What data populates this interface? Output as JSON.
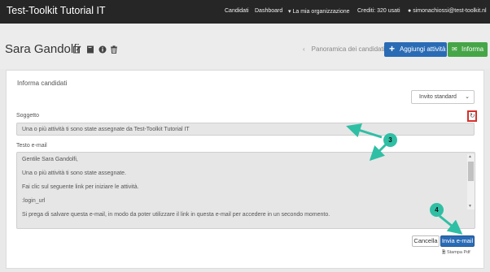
{
  "topnav": {
    "brand": "Test-Toolkit Tutorial IT",
    "items": [
      {
        "label": "Candidati"
      },
      {
        "label": "Dashboard"
      },
      {
        "label": "La mia organizzazione"
      },
      {
        "label": "Crediti: 320 usati"
      },
      {
        "label": "simonachiossi@test-toolkit.nl"
      }
    ]
  },
  "header": {
    "title": "Sara Gandolfi",
    "icons": [
      "edit-icon",
      "notes-icon",
      "info-icon",
      "trash-icon"
    ],
    "back_link": "Panoramica dei candidati",
    "add_activity": "Aggiungi attività",
    "inform": "Informa"
  },
  "panel": {
    "title": "Informa candidati",
    "template_select": "Invito standard",
    "subject_label": "Soggetto",
    "subject_value": "Una o più attività ti sono state assegnate da Test-Toolkit Tutorial IT",
    "email_label": "Testo e-mail",
    "email_lines": [
      "Gentile Sara Gandolfi,",
      "Una o più attività ti sono state assegnate.",
      "Fai clic sul seguente link per iniziare le attività.",
      ":login_url",
      "Si prega di salvare questa e-mail, in modo da poter utilizzare il link in questa e-mail per accedere in un secondo momento."
    ],
    "cancel": "Cancella",
    "send": "Invia e-mail",
    "print": "Stampa Pdf"
  },
  "annotations": [
    "3",
    "4"
  ],
  "colors": {
    "topbar": "#262626",
    "primary": "#2a6bb5",
    "success": "#46a546",
    "highlight": "#d9302c",
    "annotation": "#2fbfa4"
  }
}
